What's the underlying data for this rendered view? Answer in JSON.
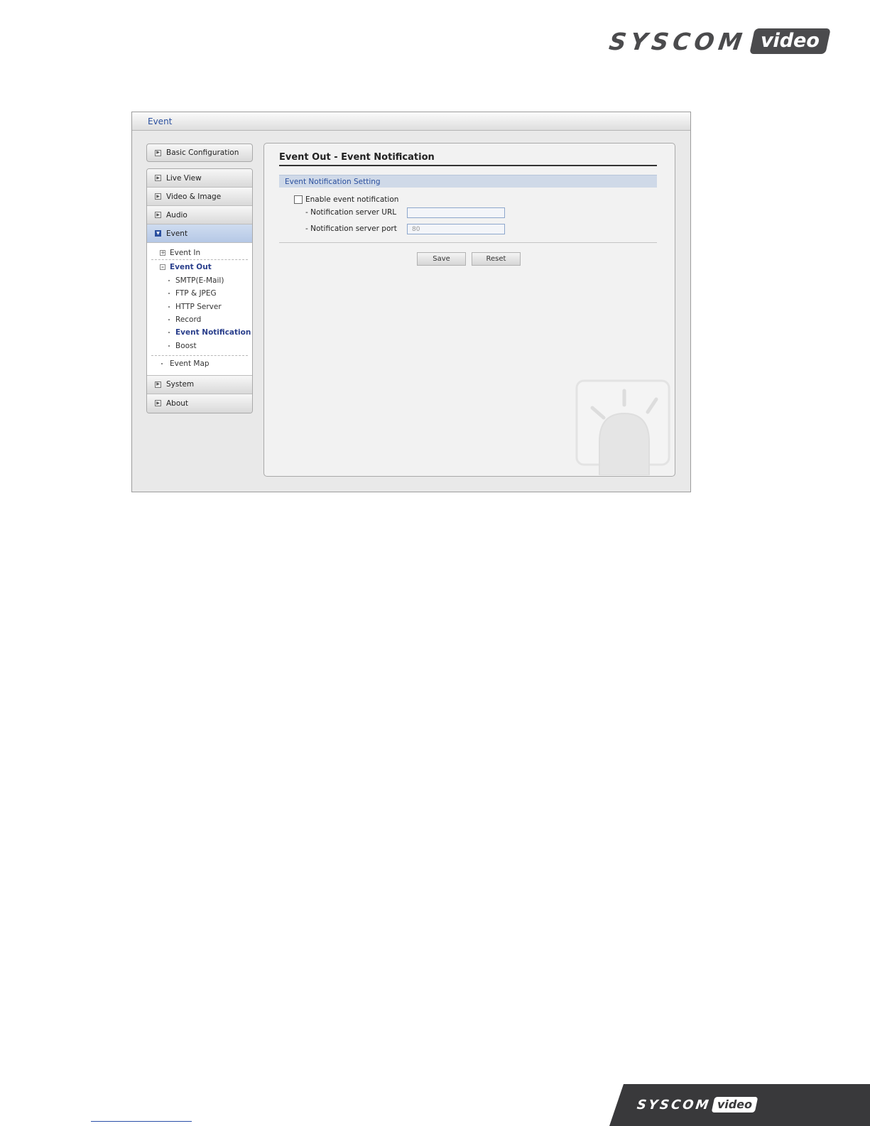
{
  "brand": {
    "word": "SYSCOM",
    "pill": "video"
  },
  "window": {
    "header_title": "Event"
  },
  "sidebar": {
    "basic": "Basic Configuration",
    "items": [
      "Live View",
      "Video & Image",
      "Audio",
      "Event"
    ],
    "event_sub": {
      "event_in": "Event In",
      "event_out": "Event Out",
      "leaves": [
        "SMTP(E-Mail)",
        "FTP & JPEG",
        "HTTP Server",
        "Record",
        "Event Notification",
        "Boost"
      ],
      "event_map": "Event Map"
    },
    "bottom_items": [
      "System",
      "About"
    ]
  },
  "content": {
    "title": "Event Out - Event Notification",
    "section": "Event Notification Setting",
    "enable_label": "Enable event notification",
    "url_label": "- Notification server URL",
    "url_value": "",
    "port_label": "- Notification server port",
    "port_value": "80",
    "save_label": "Save",
    "reset_label": "Reset"
  }
}
